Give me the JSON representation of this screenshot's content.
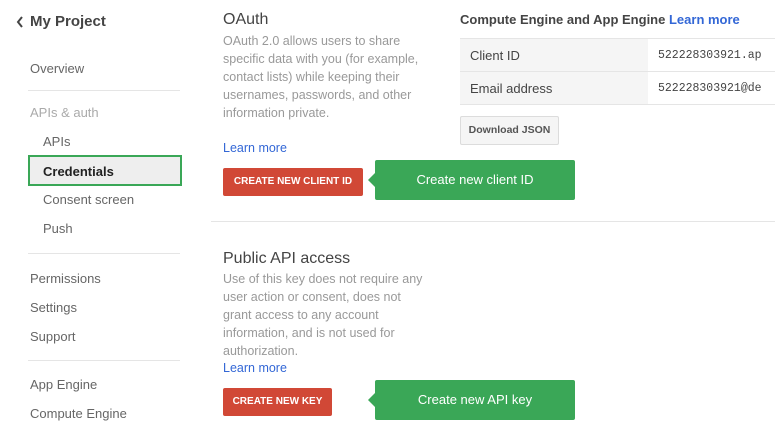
{
  "sidebar": {
    "back_label": "My Project",
    "overview": "Overview",
    "apis_auth_label": "APIs & auth",
    "apis": "APIs",
    "credentials": "Credentials",
    "consent_screen": "Consent screen",
    "push": "Push",
    "permissions": "Permissions",
    "settings": "Settings",
    "support": "Support",
    "app_engine": "App Engine",
    "compute_engine": "Compute Engine"
  },
  "oauth": {
    "title": "OAuth",
    "description": "OAuth 2.0 allows users to share specific data with you (for example, contact lists) while keeping their usernames, passwords, and other information private.",
    "learn_more": "Learn more",
    "create_button": "CREATE NEW CLIENT ID",
    "callout": "Create new client ID"
  },
  "compute": {
    "title": "Compute Engine and App Engine",
    "learn_more": "Learn more",
    "rows": [
      {
        "key": "Client ID",
        "value": "522228303921.ap"
      },
      {
        "key": "Email address",
        "value": "522228303921@de"
      }
    ],
    "download_button": "Download JSON"
  },
  "public_api": {
    "title": "Public API access",
    "description": "Use of this key does not require any user action or consent, does not grant access to any account information, and is not used for authorization.",
    "learn_more": "Learn more",
    "create_button": "CREATE NEW KEY",
    "callout": "Create new API key"
  },
  "colors": {
    "accent_green": "#3aa757",
    "button_red": "#d14836",
    "link_blue": "#3367d6"
  }
}
